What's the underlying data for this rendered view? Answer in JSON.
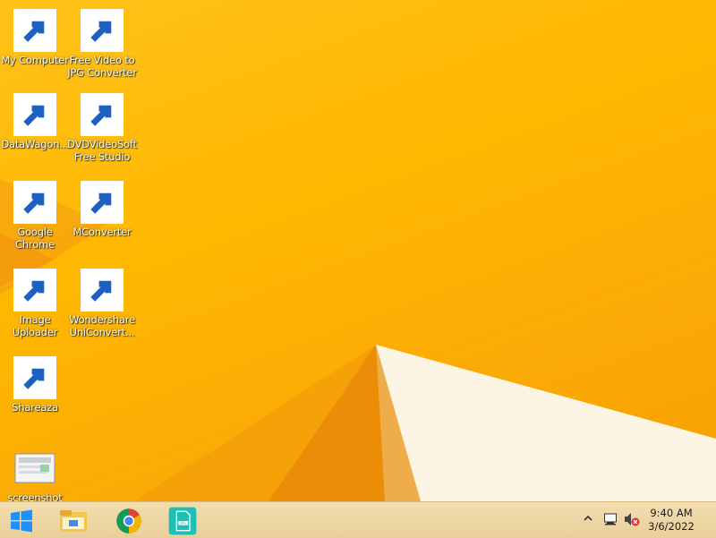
{
  "desktop": {
    "icons": [
      {
        "label": "My Computer",
        "icon": "computer-icon"
      },
      {
        "label": "Free Video to JPG Converter",
        "icon": "jpg-file-icon"
      },
      {
        "label": "DataWagon...",
        "icon": "datawagon-icon"
      },
      {
        "label": "DVDVideoSoft Free Studio",
        "icon": "dvdvideosoft-icon"
      },
      {
        "label": "Google Chrome",
        "icon": "chrome-icon"
      },
      {
        "label": "MConverter",
        "icon": "mconverter-icon"
      },
      {
        "label": "Image Uploader",
        "icon": "image-uploader-icon"
      },
      {
        "label": "Wondershare UniConvert...",
        "icon": "wondershare-icon"
      },
      {
        "label": "Shareaza",
        "icon": "shareaza-icon"
      },
      {
        "label": "screenshot",
        "icon": "screenshot-file-icon"
      }
    ]
  },
  "taskbar": {
    "pinned": [
      "file-explorer-icon",
      "chrome-icon",
      "jpg-converter-icon"
    ],
    "tray": [
      "show-hidden-icons-chevron",
      "network-icon",
      "volume-muted-icon"
    ],
    "clock": {
      "time": "9:40 AM",
      "date": "3/6/2022"
    }
  },
  "colors": {
    "wallpaper": "#ffb800",
    "taskbar": "#efd8a6",
    "accent_teal": "#1dc0b6",
    "windows_blue": "#1e90ff"
  }
}
